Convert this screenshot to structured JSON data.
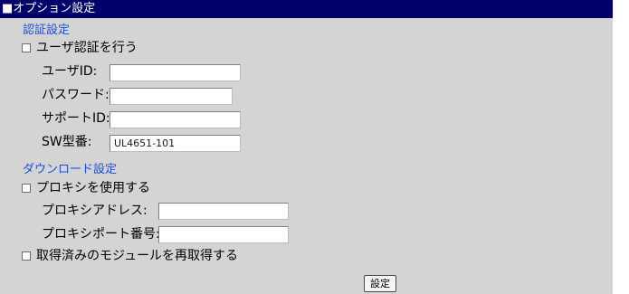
{
  "title": "■オプション設定",
  "auth": {
    "section_label": "認証設定",
    "use_auth_label": "ユーザ認証を行う",
    "user_id_label": "ユーザID:",
    "user_id_value": "",
    "password_label": "パスワード:",
    "password_value": "",
    "support_id_label": "サポートID:",
    "support_id_value": "",
    "sw_model_label": "SW型番:",
    "sw_model_value": "UL4651-101"
  },
  "download": {
    "section_label": "ダウンロード設定",
    "use_proxy_label": "プロキシを使用する",
    "proxy_address_label": "プロキシアドレス:",
    "proxy_address_value": "",
    "proxy_port_label": "プロキシポート番号:",
    "proxy_port_value": "",
    "reacquire_label": "取得済みのモジュールを再取得する"
  },
  "submit_label": "設定",
  "colors": {
    "title_bg": "#00006a",
    "panel_bg": "#d4d4d4",
    "section_text": "#1f4fd8"
  }
}
